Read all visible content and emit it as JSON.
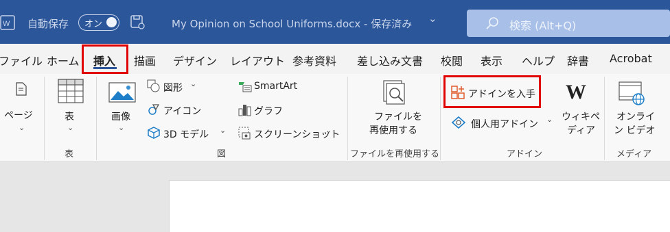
{
  "titlebar": {
    "autosave_label": "自動保存",
    "toggle_state": "オン",
    "document_title": "My Opinion on School Uniforms.docx - 保存済み",
    "dropdown_glyph": "⌄",
    "search_placeholder": "検索 (Alt+Q)"
  },
  "tabs": [
    "ファイル",
    "ホーム",
    "挿入",
    "描画",
    "デザイン",
    "レイアウト",
    "参考資料",
    "差し込み文書",
    "校閲",
    "表示",
    "ヘルプ",
    "辞書",
    "Acrobat"
  ],
  "active_tab": "挿入",
  "ribbon": {
    "page_label": "ページ",
    "table_label": "表",
    "table_group": "表",
    "picture_label": "画像",
    "shapes_label": "図形",
    "icons_label": "アイコン",
    "model3d_label": "3D モデル",
    "smartart_label": "SmartArt",
    "graph_label": "グラフ",
    "screenshot_label": "スクリーンショット",
    "illustrations_group": "図",
    "reuse_label_1": "ファイルを",
    "reuse_label_2": "再使用する",
    "reuse_group": "ファイルを再使用する",
    "get_addins_label": "アドインを入手",
    "my_addins_label": "個人用アドイン",
    "wiki_label_1": "ウィキペ",
    "wiki_label_2": "ディア",
    "addins_group": "アドイン",
    "online_video_1": "オンライ",
    "online_video_2": "ン ビデオ",
    "media_group": "メディア"
  }
}
